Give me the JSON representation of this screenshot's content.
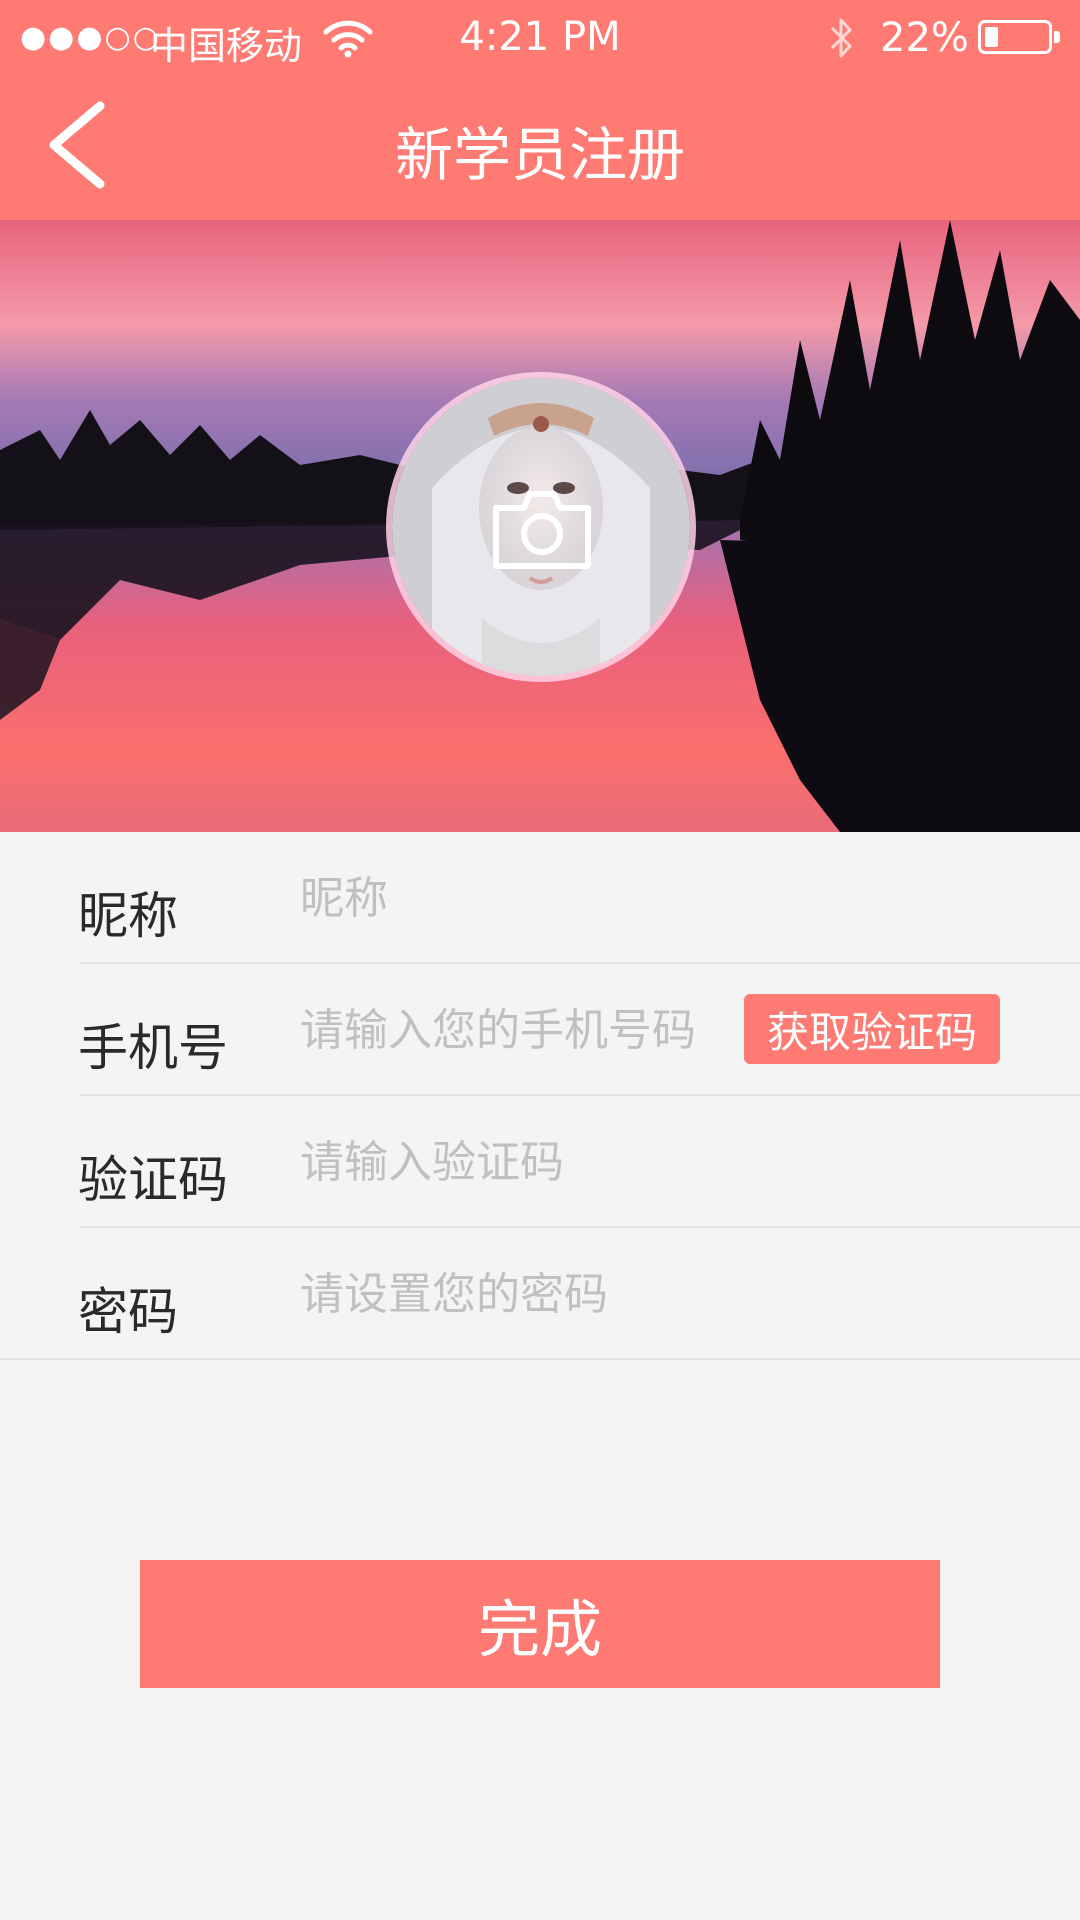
{
  "status_bar": {
    "signal": "●●●○○",
    "carrier": "中国移动",
    "time": "4:21 PM",
    "battery": "22%",
    "battery_level": 0.22
  },
  "header": {
    "title": "新学员注册"
  },
  "icons": {
    "back": "chevron-left",
    "wifi": "wifi",
    "bluetooth": "bluetooth",
    "camera": "camera"
  },
  "form": {
    "nickname": {
      "label": "昵称",
      "placeholder": "昵称",
      "value": ""
    },
    "phone": {
      "label": "手机号",
      "placeholder": "请输入您的手机号码",
      "value": "",
      "code_button": "获取验证码"
    },
    "code": {
      "label": "验证码",
      "placeholder": "请输入验证码",
      "value": ""
    },
    "password": {
      "label": "密码",
      "placeholder": "请设置您的密码",
      "value": ""
    }
  },
  "submit_label": "完成",
  "colors": {
    "accent": "#fe7a72",
    "background": "#f4f4f4",
    "label": "#2a2a2a",
    "placeholder": "#c0c0c0"
  }
}
